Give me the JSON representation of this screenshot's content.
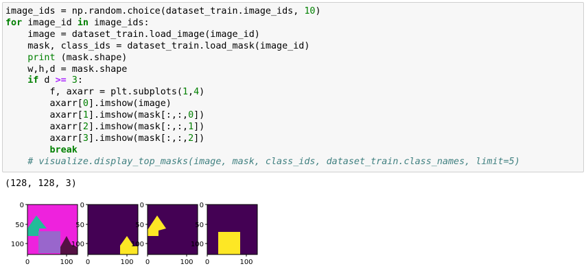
{
  "cell": {
    "code_lines": [
      [
        {
          "t": "image_ids = np.random.choice(dataset_train.image_ids, "
        },
        {
          "t": "10",
          "c": "num"
        },
        {
          "t": ")"
        }
      ],
      [
        {
          "t": "for",
          "c": "kw"
        },
        {
          "t": " image_id "
        },
        {
          "t": "in",
          "c": "kw"
        },
        {
          "t": " image_ids:"
        }
      ],
      [
        {
          "t": "    image = dataset_train.load_image(image_id)"
        }
      ],
      [
        {
          "t": "    mask, class_ids = dataset_train.load_mask(image_id)"
        }
      ],
      [
        {
          "t": "    "
        },
        {
          "t": "print",
          "c": "bi"
        },
        {
          "t": " (mask.shape)"
        }
      ],
      [
        {
          "t": "    w,h,d = mask.shape"
        }
      ],
      [
        {
          "t": "    "
        },
        {
          "t": "if",
          "c": "kw"
        },
        {
          "t": " d "
        },
        {
          "t": ">=",
          "c": "op"
        },
        {
          "t": " "
        },
        {
          "t": "3",
          "c": "num"
        },
        {
          "t": ":"
        }
      ],
      [
        {
          "t": "        f, axarr = plt.subplots("
        },
        {
          "t": "1",
          "c": "num"
        },
        {
          "t": ","
        },
        {
          "t": "4",
          "c": "num"
        },
        {
          "t": ")"
        }
      ],
      [
        {
          "t": "        axarr["
        },
        {
          "t": "0",
          "c": "num"
        },
        {
          "t": "].imshow(image)"
        }
      ],
      [
        {
          "t": "        axarr["
        },
        {
          "t": "1",
          "c": "num"
        },
        {
          "t": "].imshow(mask[:,:,"
        },
        {
          "t": "0",
          "c": "num"
        },
        {
          "t": "])"
        }
      ],
      [
        {
          "t": "        axarr["
        },
        {
          "t": "2",
          "c": "num"
        },
        {
          "t": "].imshow(mask[:,:,"
        },
        {
          "t": "1",
          "c": "num"
        },
        {
          "t": "])"
        }
      ],
      [
        {
          "t": "        axarr["
        },
        {
          "t": "3",
          "c": "num"
        },
        {
          "t": "].imshow(mask[:,:,"
        },
        {
          "t": "2",
          "c": "num"
        },
        {
          "t": "])"
        }
      ],
      [
        {
          "t": "        "
        },
        {
          "t": "break",
          "c": "kw"
        }
      ],
      [
        {
          "t": "    "
        },
        {
          "t": "# visualize.display_top_masks(image, mask, class_ids, dataset_train.class_names, limit=5)",
          "c": "cm"
        }
      ]
    ]
  },
  "output": {
    "stdout": "(128, 128, 3)"
  },
  "figure": {
    "y_ticks": [
      "0",
      "50",
      "100"
    ],
    "x_ticks": [
      "0",
      "100"
    ],
    "panel_count": 4,
    "colors": {
      "background_magenta": "#ee22dd",
      "teal_triangle": "#22bb99",
      "lavender_square": "#9966cc",
      "dark_triangle": "#551144",
      "mask_background": "#440154",
      "mask_foreground": "#fde725"
    }
  }
}
